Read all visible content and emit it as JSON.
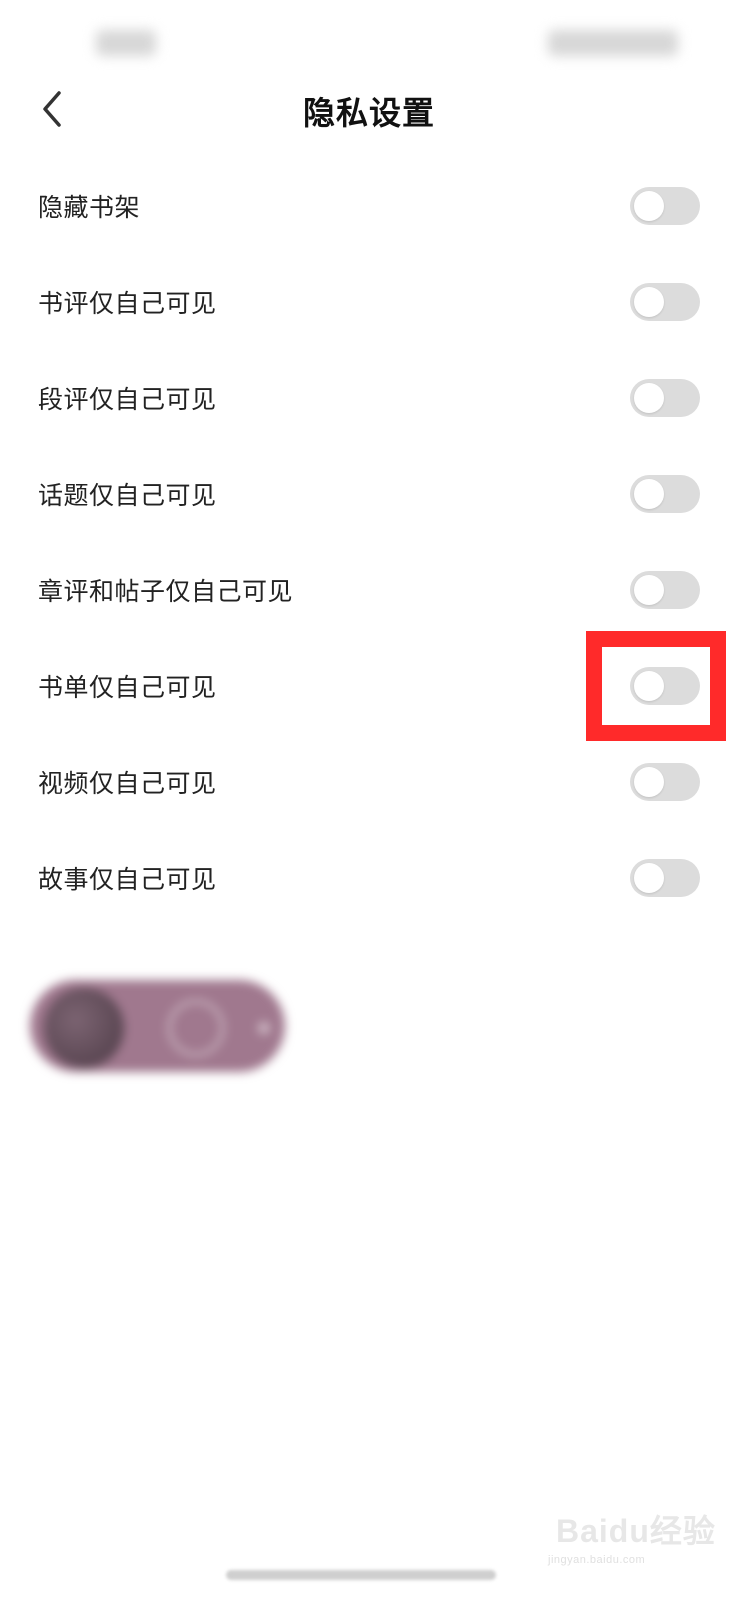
{
  "header": {
    "title": "隐私设置",
    "back_icon": "chevron-left-icon"
  },
  "settings": [
    {
      "label": "隐藏书架",
      "enabled": false
    },
    {
      "label": "书评仅自己可见",
      "enabled": false
    },
    {
      "label": "段评仅自己可见",
      "enabled": false
    },
    {
      "label": "话题仅自己可见",
      "enabled": false
    },
    {
      "label": "章评和帖子仅自己可见",
      "enabled": false
    },
    {
      "label": "书单仅自己可见",
      "enabled": false,
      "highlighted": true
    },
    {
      "label": "视频仅自己可见",
      "enabled": false
    },
    {
      "label": "故事仅自己可见",
      "enabled": false
    }
  ],
  "colors": {
    "toggle_off": "#dcdcdc",
    "highlight": "#ff2a2a",
    "text": "#222222"
  },
  "watermark": {
    "brand": "Baidu经验",
    "url": "jingyan.baidu.com"
  }
}
